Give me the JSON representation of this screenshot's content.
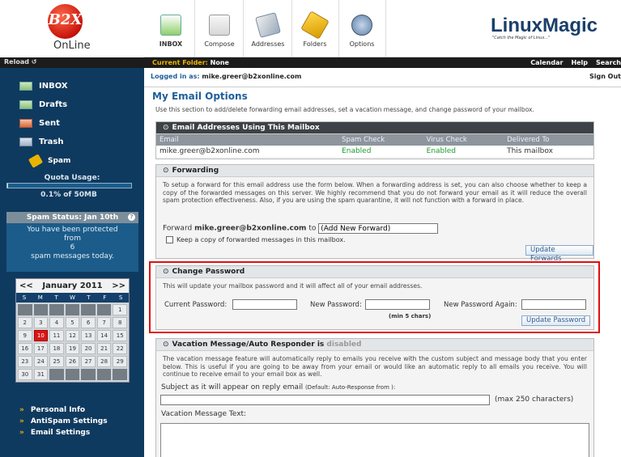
{
  "sidebar": {
    "logo_text": "B2X",
    "logo_sub": "OnLine",
    "reload": "Reload ↺",
    "folders": [
      {
        "label": "INBOX",
        "icon": "inbox-icon"
      },
      {
        "label": "Drafts",
        "icon": "drafts-icon"
      },
      {
        "label": "Sent",
        "icon": "sent-icon"
      },
      {
        "label": "Trash",
        "icon": "trash-icon"
      },
      {
        "label": "Spam",
        "icon": "spam-icon"
      }
    ],
    "quota_label": "Quota Usage:",
    "quota_value": "0.1% of 50MB",
    "quota_fraction": 0.001,
    "spam_status_title": "Spam Status: Jan 10th",
    "spam_status_line1": "You have been protected",
    "spam_status_line2": "from",
    "spam_status_count": "6",
    "spam_status_line3": "spam messages today.",
    "links": [
      "Personal Info",
      "AntiSpam Settings",
      "Email Settings"
    ]
  },
  "calendar": {
    "prev": "<<",
    "month": "January 2011",
    "next": ">>",
    "weekdays": [
      "S",
      "M",
      "T",
      "W",
      "T",
      "F",
      "S"
    ],
    "weeks": [
      [
        "",
        "",
        "",
        "",
        "",
        "",
        "1"
      ],
      [
        "2",
        "3",
        "4",
        "5",
        "6",
        "7",
        "8"
      ],
      [
        "9",
        "10",
        "11",
        "12",
        "13",
        "14",
        "15"
      ],
      [
        "16",
        "17",
        "18",
        "19",
        "20",
        "21",
        "22"
      ],
      [
        "23",
        "24",
        "25",
        "26",
        "27",
        "28",
        "29"
      ],
      [
        "30",
        "31",
        "",
        "",
        "",
        "",
        ""
      ]
    ],
    "today": "10"
  },
  "toolbar": {
    "inbox": "INBOX",
    "compose": "Compose",
    "addresses": "Addresses",
    "folders": "Folders",
    "options": "Options",
    "brand_linux": "Linux",
    "brand_magic": "Magic",
    "brand_tag": "\"Catch the Magic of Linux...\""
  },
  "menubar": {
    "folder_key": "Current Folder:",
    "folder_value": "None",
    "calendar": "Calendar",
    "help": "Help",
    "search": "Search"
  },
  "session": {
    "logged_in_label": "Logged in as:",
    "user": "mike.greer@b2xonline.com",
    "signout": "Sign Out"
  },
  "main": {
    "title": "My Email Options",
    "intro": "Use this section to add/delete forwarding email addresses, set a vacation message, and change password of your mailbox.",
    "addresses_panel": {
      "title": "Email Addresses Using This Mailbox",
      "columns": [
        "Email",
        "Spam Check",
        "Virus Check",
        "Delivered To"
      ],
      "rows": [
        [
          "mike.greer@b2xonline.com",
          "Enabled",
          "Enabled",
          "This mailbox"
        ]
      ]
    },
    "forwarding": {
      "title": "Forwarding",
      "text": "To setup a forward for this email address use the form below. When a forwarding address is set, you can also choose whether to keep a copy of the forwarded messages on this server. We highly recommend that you do not forward your email as it will reduce the overall spam protection effectiveness. Also, if you are using the spam quarantine, it will not function with a forward in place.",
      "forward_label": "Forward",
      "forward_address": "mike.greer@b2xonline.com",
      "to_label": "to",
      "forward_value": "(Add New Forward)",
      "keep_copy_label": "Keep a copy of forwarded messages in this mailbox.",
      "button": "Update Forwards"
    },
    "password": {
      "title": "Change Password",
      "text": "This will update your mailbox password and it will affect all of your email addresses.",
      "current_label": "Current Password:",
      "new_label": "New Password:",
      "again_label": "New Password Again:",
      "hint": "(min 5 chars)",
      "button": "Update Password"
    },
    "vacation": {
      "title": "Vacation Message/Auto Responder is",
      "status": "disabled",
      "text": "The vacation message feature will automatically reply to emails you receive with the custom subject and message body that you enter below. This is useful if you are going to be away from your email or would like an automatic reply to all emails you receive. You will continue to receive email to your email box as well.",
      "subject_label": "Subject as it will appear on reply email",
      "subject_hint": "(Default: Auto-Response from ):",
      "max_label": "(max 250 characters)",
      "message_label": "Vacation Message Text:"
    }
  }
}
